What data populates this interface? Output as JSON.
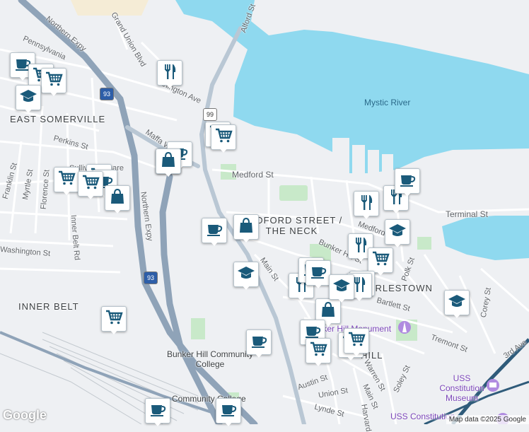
{
  "map": {
    "colors": {
      "water": "#8fd9ef",
      "land": "#eef0f3",
      "highway": "#8fa3b8",
      "road": "#ffffff",
      "park": "#c8e9c9",
      "marker_icon": "#1a5a7a"
    },
    "water_labels": {
      "mystic": "Mystic River"
    },
    "area_labels": {
      "east_somerville": "EAST SOMERVILLE",
      "inner_belt": "INNER BELT",
      "medford_neck": "MEDFORD STREET / THE NECK",
      "charlestown": "CHARLESTOWN",
      "hill": "HILL"
    },
    "street_labels": {
      "northern_expy_top": "Northern Expy",
      "northern_expy_side": "Northern Expy",
      "grand_union": "Grand Union Blvd",
      "alford": "Alford St",
      "arlington": "Arlington Ave",
      "pennsylvania": "Pennsylvania",
      "perkins": "Perkins St",
      "franklin": "Franklin St",
      "myrtle": "Myrtle St",
      "florence": "Florence St",
      "inner_belt_rd": "Inner Belt Rd",
      "washington": "Washington St",
      "medford": "Medford St",
      "medford2": "Medford St",
      "terminal": "Terminal St",
      "main": "Main St",
      "main2": "Main St",
      "bunker_hill": "Bunker Hill St",
      "polk": "Polk St",
      "corey": "Corey St",
      "bartlett": "Bartlett St",
      "tremont": "Tremont St",
      "third_ave": "3rd Ave",
      "austin": "Austin St",
      "union": "Union St",
      "warren": "Warren St",
      "soley": "Soley St",
      "harvard": "Harvard",
      "lynde": "Lynde St",
      "maffa": "Maffa Way",
      "sullivan": "Sullivan Square"
    },
    "poi_labels": {
      "bhcc": "Bunker Hill Community College",
      "cc_station": "Community College",
      "monument": "Bunker Hill Monument",
      "uss_museum": "USS Constitution Museum",
      "uss": "USS Constitution"
    },
    "shields": {
      "i93a": "93",
      "i93b": "93",
      "rt99": "99"
    },
    "attribution": "Map data ©2025 Google",
    "logo": "Google"
  },
  "markers": [
    {
      "type": "coffee",
      "icon": "coffee-icon"
    },
    {
      "type": "shopping",
      "icon": "cart-icon"
    },
    {
      "type": "shopping",
      "icon": "cart-icon"
    },
    {
      "type": "school",
      "icon": "graduation-cap-icon"
    },
    {
      "type": "restaurant",
      "icon": "utensils-icon"
    },
    {
      "type": "shopping",
      "icon": "cart-icon"
    },
    {
      "type": "shopping",
      "icon": "cart-icon"
    },
    {
      "type": "coffee",
      "icon": "coffee-icon"
    },
    {
      "type": "store",
      "icon": "shopping-bag-icon"
    },
    {
      "type": "shopping",
      "icon": "cart-icon"
    },
    {
      "type": "shopping",
      "icon": "cart-icon"
    },
    {
      "type": "shopping",
      "icon": "cart-icon"
    },
    {
      "type": "store",
      "icon": "shopping-bag-icon"
    },
    {
      "type": "coffee",
      "icon": "coffee-icon"
    },
    {
      "type": "store",
      "icon": "shopping-bag-icon"
    },
    {
      "type": "school",
      "icon": "graduation-cap-icon"
    },
    {
      "type": "shopping",
      "icon": "cart-icon"
    },
    {
      "type": "coffee",
      "icon": "coffee-icon"
    },
    {
      "type": "coffee",
      "icon": "coffee-icon"
    },
    {
      "type": "coffee",
      "icon": "coffee-icon"
    },
    {
      "type": "coffee",
      "icon": "coffee-icon"
    },
    {
      "type": "restaurant",
      "icon": "utensils-icon"
    },
    {
      "type": "restaurant",
      "icon": "utensils-icon"
    },
    {
      "type": "school",
      "icon": "graduation-cap-icon"
    },
    {
      "type": "restaurant",
      "icon": "utensils-icon"
    },
    {
      "type": "shopping",
      "icon": "cart-icon"
    },
    {
      "type": "restaurant",
      "icon": "utensils-icon"
    },
    {
      "type": "coffee",
      "icon": "coffee-icon"
    },
    {
      "type": "store",
      "icon": "shopping-bag-icon"
    },
    {
      "type": "school",
      "icon": "graduation-cap-icon"
    },
    {
      "type": "restaurant",
      "icon": "utensils-icon"
    },
    {
      "type": "restaurant",
      "icon": "utensils-icon"
    },
    {
      "type": "coffee",
      "icon": "coffee-icon"
    },
    {
      "type": "coffee",
      "icon": "coffee-icon"
    },
    {
      "type": "store",
      "icon": "shopping-bag-icon"
    },
    {
      "type": "coffee",
      "icon": "coffee-icon"
    },
    {
      "type": "shopping",
      "icon": "cart-icon"
    },
    {
      "type": "shopping",
      "icon": "cart-icon"
    },
    {
      "type": "shopping",
      "icon": "cart-icon"
    },
    {
      "type": "school",
      "icon": "graduation-cap-icon"
    }
  ]
}
